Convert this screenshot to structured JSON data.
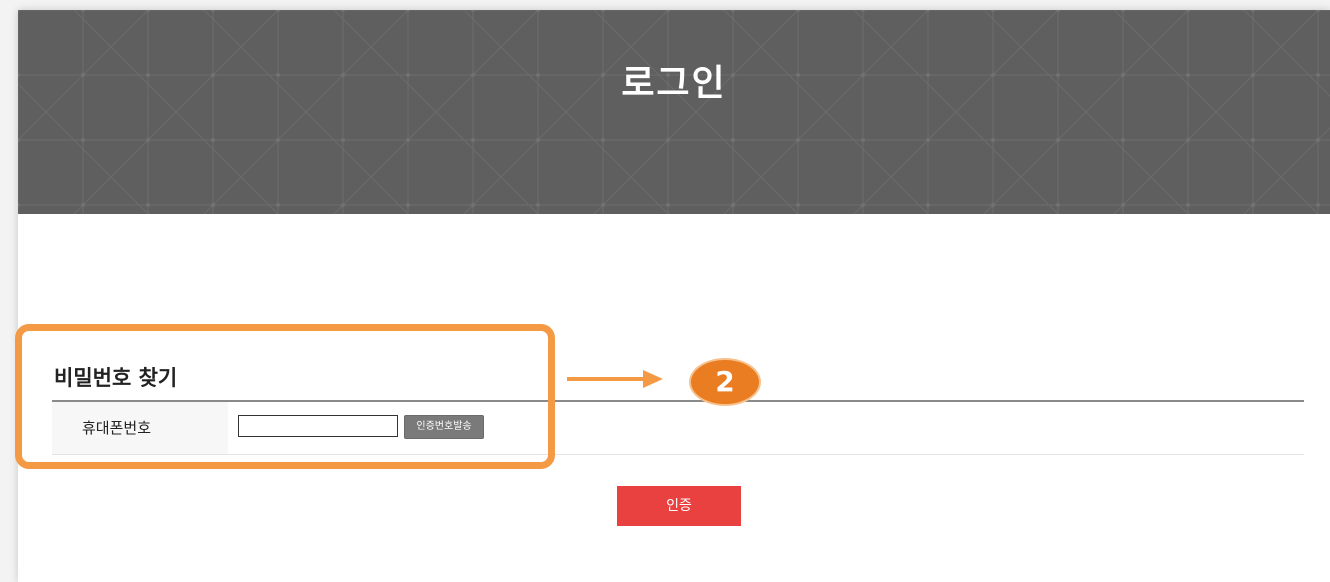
{
  "header": {
    "title": "로그인"
  },
  "find_password": {
    "section_title": "비밀번호 찾기",
    "phone_label": "휴대폰번호",
    "phone_value": "",
    "send_code_label": "인증번호발송",
    "auth_button_label": "인증"
  },
  "annotation": {
    "step_number": "2"
  },
  "colors": {
    "header_bg": "#5f5f5f",
    "auth_button": "#e8413f",
    "send_button": "#7a7a7a",
    "annotation": "#f49a44",
    "badge": "#ea7c22"
  }
}
